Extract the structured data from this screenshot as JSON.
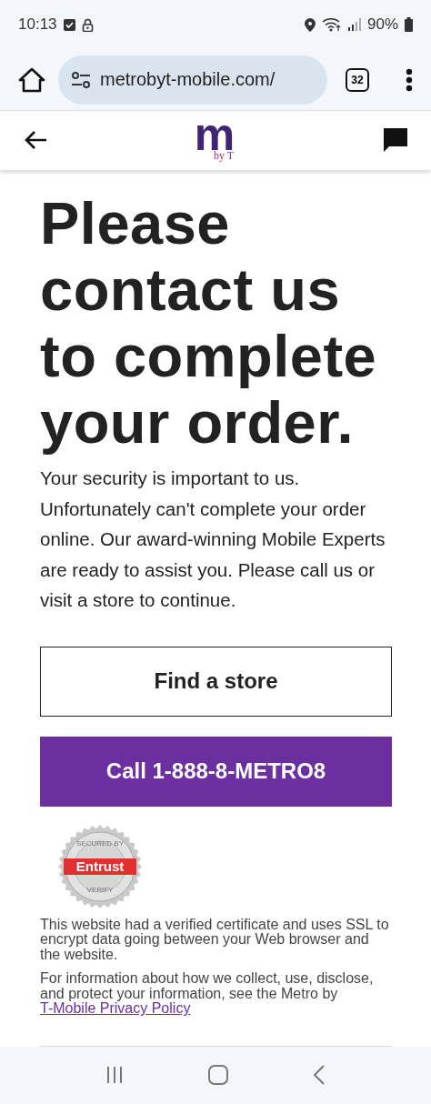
{
  "status_bar": {
    "time": "10:13",
    "battery": "90%"
  },
  "browser": {
    "url": "metrobyt-mobile.com/",
    "tab_count": "32"
  },
  "header": {
    "logo": {
      "letter": "m",
      "byline": "by T"
    }
  },
  "heading": "Please contact us to complete your order.",
  "message": "Your security is important to us. Unfortunately can't complete your order online. Our award-winning Mobile Experts are ready to assist you. Please call us or visit a store to continue.",
  "buttons": [
    {
      "label": "Find a store",
      "kind": "outline"
    },
    {
      "label": "Call 1-888-8-METRO8",
      "kind": "filled"
    }
  ],
  "seal": {
    "top": "SECURED BY",
    "brand": "Entrust",
    "bottom": "VERIFY"
  },
  "ssl_note": "This website had a verified certificate and uses SSL to encrypt data going between your Web browser and the website.",
  "privacy_note": {
    "text": "For information about how we collect, use, disclose, and protect your information, see the Metro by ",
    "link": "T-Mobile Privacy Policy"
  }
}
